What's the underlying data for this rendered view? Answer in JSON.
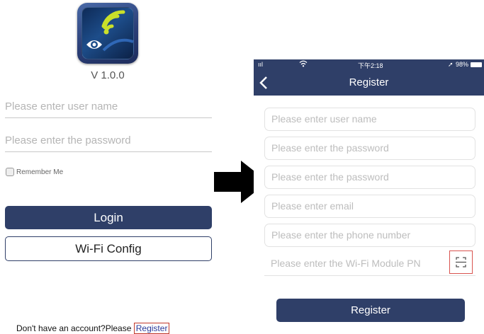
{
  "login": {
    "version": "V 1.0.0",
    "username_placeholder": "Please enter user name",
    "password_placeholder": "Please enter the password",
    "remember_label": "Remember Me",
    "login_label": "Login",
    "wifi_config_label": "Wi-Fi Config",
    "no_account_text": "Don't have an account?Please ",
    "register_link_label": "Register"
  },
  "register_screen": {
    "status_bar": {
      "signal": "ııl",
      "time": "下午2:18",
      "battery": "98%"
    },
    "title": "Register",
    "fields": [
      "Please enter user name",
      "Please enter the password",
      "Please enter the password",
      "Please enter email",
      "Please enter the phone number",
      "Please enter the Wi-Fi Module PN"
    ],
    "register_label": "Register"
  },
  "colors": {
    "primary": "#2f3f68",
    "highlight": "#c0392b"
  }
}
